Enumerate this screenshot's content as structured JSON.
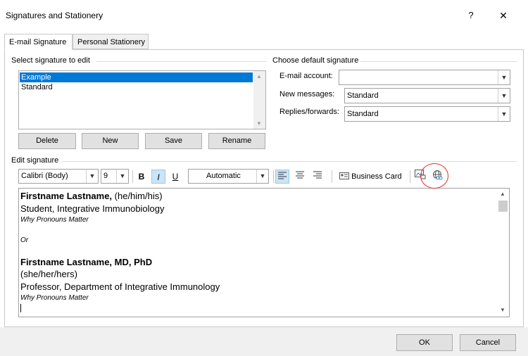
{
  "window": {
    "title": "Signatures and Stationery",
    "help_glyph": "?",
    "close_glyph": "✕"
  },
  "tabs": [
    {
      "label": "E-mail Signature",
      "active": true
    },
    {
      "label": "Personal Stationery",
      "active": false
    }
  ],
  "select_section": {
    "label": "Select signature to edit",
    "items": [
      {
        "label": "Example",
        "selected": true
      },
      {
        "label": "Standard",
        "selected": false
      }
    ],
    "buttons": {
      "delete": "Delete",
      "new": "New",
      "save": "Save",
      "rename": "Rename"
    }
  },
  "default_section": {
    "label": "Choose default signature",
    "email_account_label": "E-mail account:",
    "email_account_value": "",
    "new_messages_label": "New messages:",
    "new_messages_value": "Standard",
    "replies_label": "Replies/forwards:",
    "replies_value": "Standard"
  },
  "edit_section": {
    "label": "Edit signature",
    "font_name": "Calibri (Body)",
    "font_size": "9",
    "bold": "B",
    "italic": "I",
    "underline": "U",
    "color": "Automatic",
    "business_card": "Business Card"
  },
  "signature_lines": [
    {
      "bold": "Firstname Lastname,",
      "normal": " (he/him/his)",
      "style": "big"
    },
    {
      "bold": "",
      "normal": "Student, Integrative Immunobiology",
      "style": "big"
    },
    {
      "bold": "",
      "normal": "Why Pronouns Matter",
      "style": "small-italic"
    },
    {
      "bold": "",
      "normal": "",
      "style": "small"
    },
    {
      "bold": "",
      "normal": "Or",
      "style": "small-italic"
    },
    {
      "bold": "",
      "normal": "",
      "style": "small"
    },
    {
      "bold": "Firstname Lastname, MD, PhD",
      "normal": "",
      "style": "big"
    },
    {
      "bold": "",
      "normal": "(she/her/hers)",
      "style": "big"
    },
    {
      "bold": "",
      "normal": "Professor, Department of Integrative Immunology",
      "style": "big"
    },
    {
      "bold": "",
      "normal": "Why Pronouns Matter",
      "style": "small-italic"
    }
  ],
  "footer": {
    "ok": "OK",
    "cancel": "Cancel"
  },
  "colors": {
    "selection": "#0078d7",
    "align_active": "#cce4f7",
    "highlight_circle": "#e0302a"
  }
}
